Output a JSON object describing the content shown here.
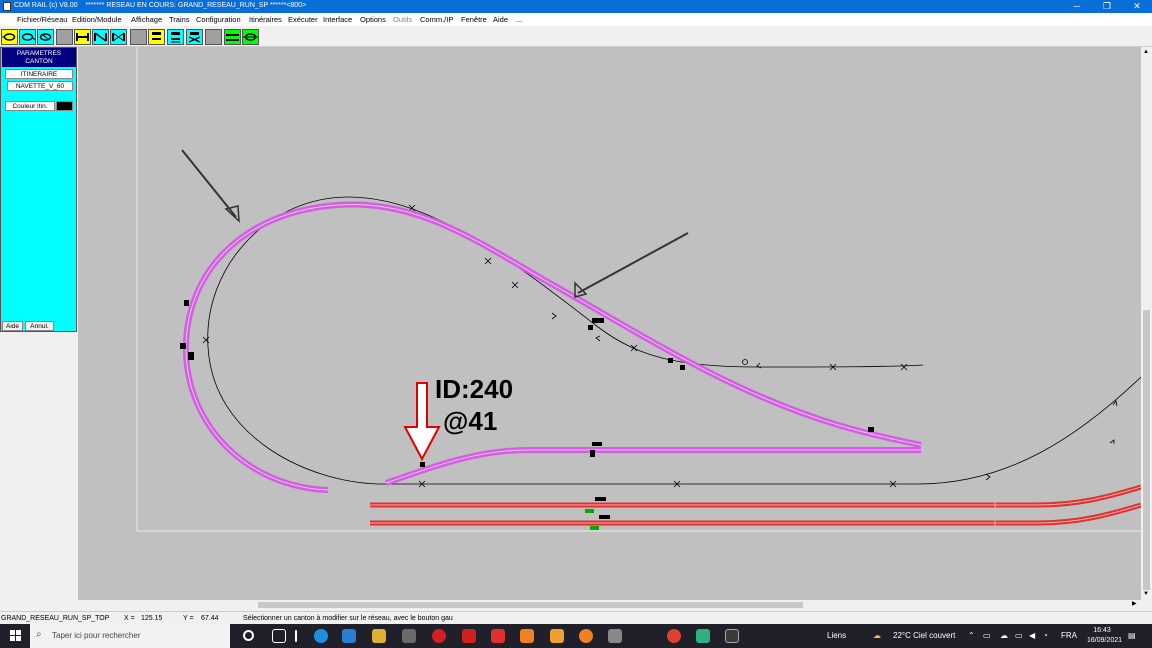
{
  "window": {
    "title": "CDM RAIL (c) V8.00    ******* RESEAU EN COURS: GRAND_RESEAU_RUN_SP ******<800>",
    "minimize_glyph": "─",
    "restore_glyph": "❐",
    "close_glyph": "✕"
  },
  "menu": [
    "Fichier/Réseau",
    "Edition/Module",
    "Affichage",
    "Trains",
    "Configuration",
    "Itinéraires",
    "Exécuter",
    "Interface",
    "Options",
    "Outils",
    "Comm./IP",
    "Fenêtre",
    "Aide",
    "..."
  ],
  "panel": {
    "header_line1": "PARAMETRES",
    "header_line2": "CANTON",
    "field_label": "ITINERAIRE",
    "field_value": "NAVETTE_V_60",
    "color_label": "Couleur Itin.",
    "color_value": "#000000",
    "help_button": "Aide",
    "cancel_button": "Annul."
  },
  "annotation": {
    "id_text": "ID:240",
    "pos_text": "@41",
    "arrow_color": "#e00000"
  },
  "status": {
    "module": "GRAND_RESEAU_RUN_SP_TOP",
    "x_label": "X =",
    "x_value": "125.15",
    "y_label": "Y =",
    "y_value": "67.44",
    "message": "Sélectionner un canton à modifier sur le réseau, avec le bouton gau"
  },
  "taskbar": {
    "search_placeholder": "Taper ici pour rechercher",
    "links_label": "Liens",
    "weather": "22°C  Ciel couvert",
    "lang": "FRA",
    "time": "16:43",
    "date": "16/09/2021"
  },
  "colors": {
    "route_highlight": "#d060e0",
    "active_track": "#e03030",
    "panel_bg": "#00ffff",
    "canvas_bg": "#c0c0c0"
  },
  "icons": [
    "loop-icon",
    "shunt-icon",
    "cross-icon",
    "blank-icon",
    "buffer-icon",
    "turntable-icon",
    "crossing-icon",
    "signal-icon",
    "station-icon",
    "double-track-icon",
    "green-loop-icon"
  ]
}
